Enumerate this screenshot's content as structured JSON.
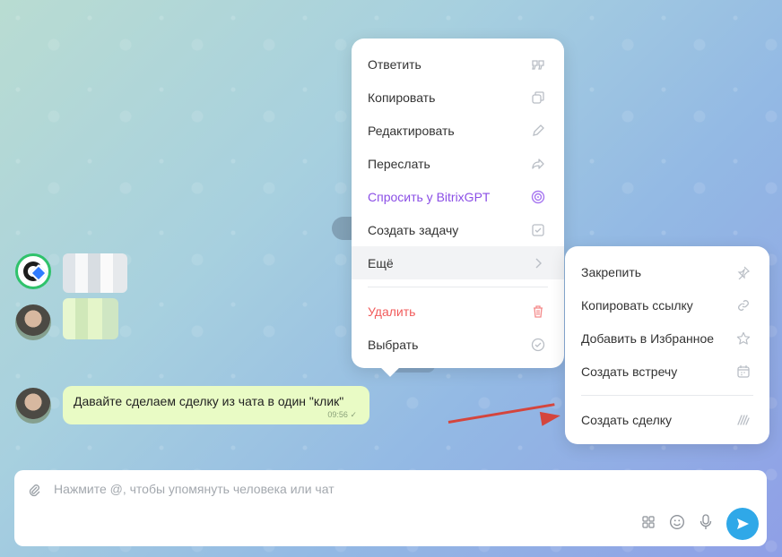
{
  "chat": {
    "message_text": "Давайте сделаем сделку из чата в один \"клик\"",
    "message_time": "09:56",
    "read_mark": "✓"
  },
  "context_menu": {
    "items": [
      {
        "label": "Ответить",
        "icon": "quote-icon"
      },
      {
        "label": "Копировать",
        "icon": "copy-icon"
      },
      {
        "label": "Редактировать",
        "icon": "pencil-icon"
      },
      {
        "label": "Переслать",
        "icon": "forward-icon"
      },
      {
        "label": "Спросить у BitrixGPT",
        "icon": "gpt-icon"
      },
      {
        "label": "Создать задачу",
        "icon": "task-check-icon"
      },
      {
        "label": "Ещё",
        "icon": "chevron-right-icon"
      },
      {
        "label": "Удалить",
        "icon": "trash-icon"
      },
      {
        "label": "Выбрать",
        "icon": "select-circle-icon"
      }
    ]
  },
  "submenu": {
    "items": [
      {
        "label": "Закрепить",
        "icon": "pin-icon"
      },
      {
        "label": "Копировать ссылку",
        "icon": "link-icon"
      },
      {
        "label": "Добавить в Избранное",
        "icon": "star-icon"
      },
      {
        "label": "Создать встречу",
        "icon": "calendar-icon"
      },
      {
        "label": "Создать сделку",
        "icon": "deal-icon"
      }
    ]
  },
  "composer": {
    "placeholder": "Нажмите @, чтобы упомянуть человека или чат"
  },
  "colors": {
    "accent_send": "#2fa8e8",
    "gpt_purple": "#8b4fe6",
    "danger_red": "#f15b5b",
    "annotation_arrow": "#d4453d",
    "bubble_green": "#e9fbc5"
  }
}
